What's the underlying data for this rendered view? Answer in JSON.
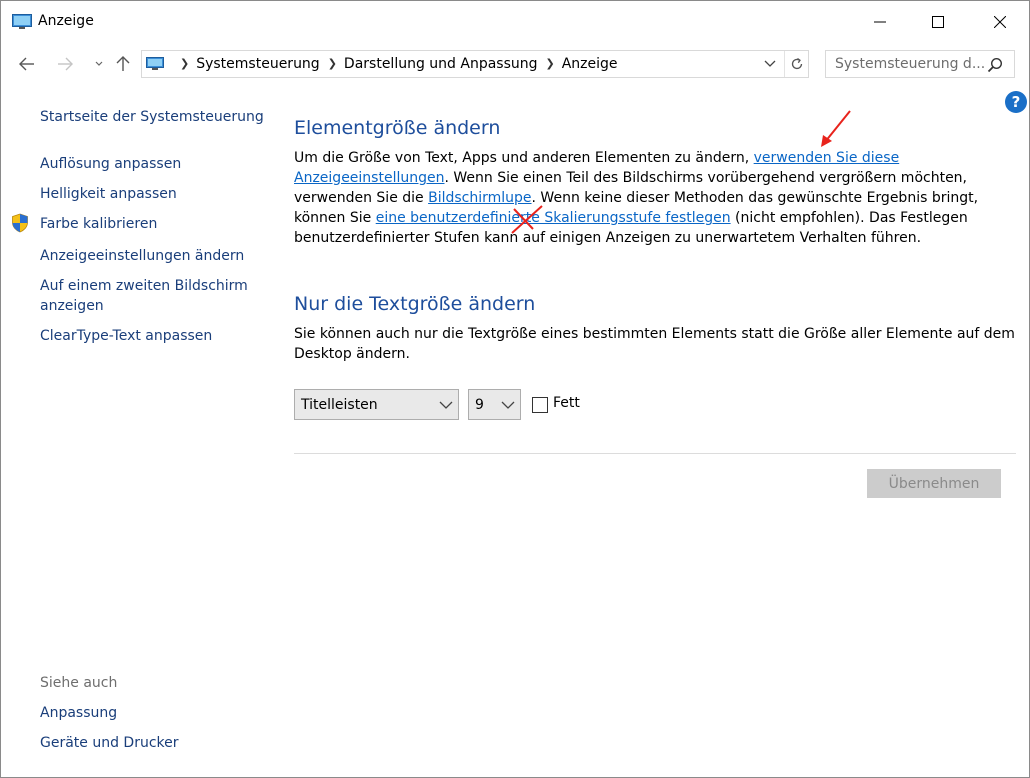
{
  "window": {
    "title": "Anzeige"
  },
  "address": {
    "crumbs": [
      "Systemsteuerung",
      "Darstellung und Anpassung",
      "Anzeige"
    ],
    "search_placeholder": "Systemsteuerung d..."
  },
  "sidebar": {
    "home": "Startseite der Systemsteuerung",
    "items": [
      "Auflösung anpassen",
      "Helligkeit anpassen",
      "Farbe kalibrieren",
      "Anzeigeeinstellungen ändern",
      "Auf einem zweiten Bildschirm",
      "anzeigen",
      "ClearType-Text anpassen"
    ],
    "see_also": "Siehe auch",
    "see_also_items": [
      "Anpassung",
      "Geräte und Drucker"
    ]
  },
  "main": {
    "section1": {
      "heading": "Elementgröße ändern",
      "line1_text": "Um die Größe von Text, Apps und anderen Elementen zu ändern, ",
      "line1_link": "verwenden Sie diese",
      "line2_link": "Anzeigeeinstellungen",
      "line2_text": ". Wenn Sie einen Teil des Bildschirms vorübergehend vergrößern möchten,",
      "line3_text_a": "verwenden Sie die ",
      "line3_link": "Bildschirmlupe",
      "line3_text_b": ". Wenn keine dieser Methoden das gewünschte Ergebnis bringt,",
      "line4_text_a": "können Sie ",
      "line4_link": "eine benutzerdefinierte Skalierungsstufe festlegen",
      "line4_text_b": " (nicht empfohlen). Das Festlegen",
      "line5_text": "benutzerdefinierter Stufen kann auf einigen Anzeigen zu unerwartetem Verhalten führen."
    },
    "section2": {
      "heading": "Nur die Textgröße ändern",
      "line1": "Sie können auch nur die Textgröße eines bestimmten Elements statt die Größe aller Elemente auf dem",
      "line2": "Desktop ändern.",
      "element_select": "Titelleisten",
      "size_select": "9",
      "bold_label": "Fett",
      "bold_checked": false
    },
    "apply_label": "Übernehmen"
  },
  "colors": {
    "link": "#0a66c6",
    "heading": "#1e4e9c",
    "annotation": "#e8231c"
  }
}
